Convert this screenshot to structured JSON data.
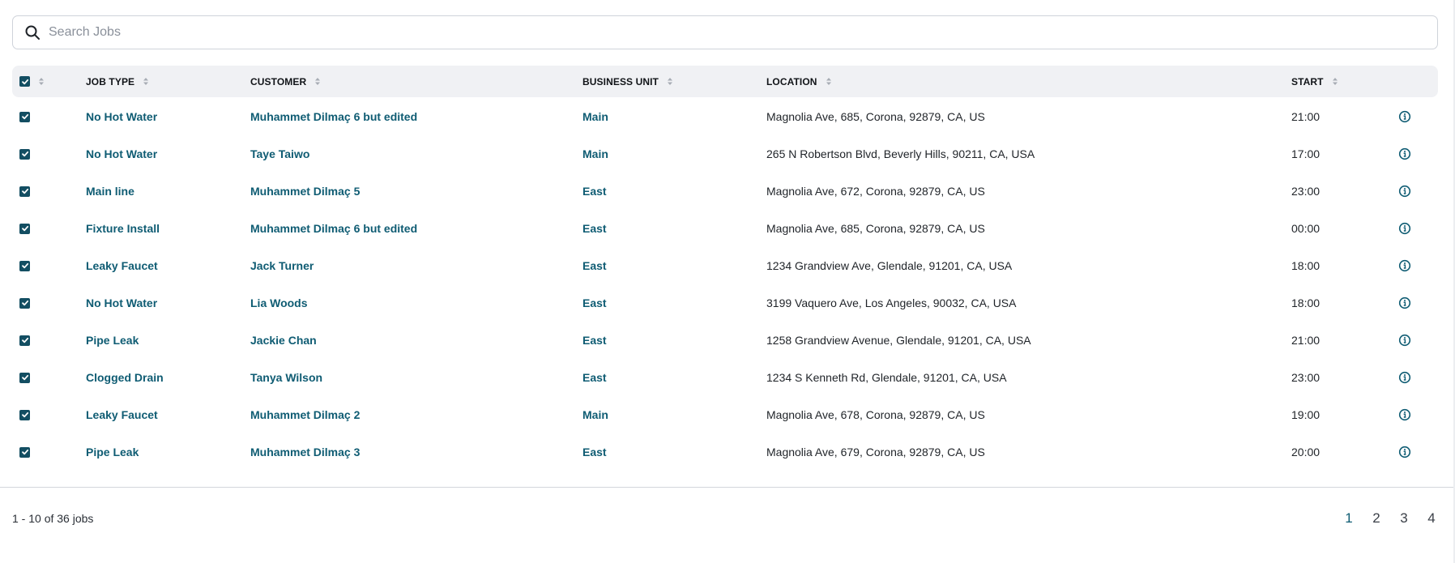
{
  "search": {
    "placeholder": "Search Jobs",
    "value": ""
  },
  "table": {
    "columns": [
      {
        "key": "select",
        "label": ""
      },
      {
        "key": "job_type",
        "label": "JOB TYPE"
      },
      {
        "key": "customer",
        "label": "CUSTOMER"
      },
      {
        "key": "business_unit",
        "label": "BUSINESS UNIT"
      },
      {
        "key": "location",
        "label": "LOCATION"
      },
      {
        "key": "start",
        "label": "START"
      }
    ],
    "select_all_checked": true,
    "rows": [
      {
        "checked": true,
        "job_type": "No Hot Water",
        "customer": "Muhammet Dilmaç 6 but edited",
        "business_unit": "Main",
        "location": "Magnolia Ave, 685, Corona, 92879, CA, US",
        "start": "21:00"
      },
      {
        "checked": true,
        "job_type": "No Hot Water",
        "customer": "Taye Taiwo",
        "business_unit": "Main",
        "location": "265 N Robertson Blvd, Beverly Hills, 90211, CA, USA",
        "start": "17:00"
      },
      {
        "checked": true,
        "job_type": "Main line",
        "customer": "Muhammet Dilmaç 5",
        "business_unit": "East",
        "location": "Magnolia Ave, 672, Corona, 92879, CA, US",
        "start": "23:00"
      },
      {
        "checked": true,
        "job_type": "Fixture Install",
        "customer": "Muhammet Dilmaç 6 but edited",
        "business_unit": "East",
        "location": "Magnolia Ave, 685, Corona, 92879, CA, US",
        "start": "00:00"
      },
      {
        "checked": true,
        "job_type": "Leaky Faucet",
        "customer": "Jack Turner",
        "business_unit": "East",
        "location": "1234 Grandview Ave, Glendale, 91201, CA, USA",
        "start": "18:00"
      },
      {
        "checked": true,
        "job_type": "No Hot Water",
        "customer": "Lia Woods",
        "business_unit": "East",
        "location": "3199 Vaquero Ave, Los Angeles, 90032, CA, USA",
        "start": "18:00"
      },
      {
        "checked": true,
        "job_type": "Pipe Leak",
        "customer": "Jackie Chan",
        "business_unit": "East",
        "location": "1258 Grandview Avenue, Glendale, 91201, CA, USA",
        "start": "21:00"
      },
      {
        "checked": true,
        "job_type": "Clogged Drain",
        "customer": "Tanya Wilson",
        "business_unit": "East",
        "location": "1234 S Kenneth Rd, Glendale, 91201, CA, USA",
        "start": "23:00"
      },
      {
        "checked": true,
        "job_type": "Leaky Faucet",
        "customer": "Muhammet Dilmaç 2",
        "business_unit": "Main",
        "location": "Magnolia Ave, 678, Corona, 92879, CA, US",
        "start": "19:00"
      },
      {
        "checked": true,
        "job_type": "Pipe Leak",
        "customer": "Muhammet Dilmaç 3",
        "business_unit": "East",
        "location": "Magnolia Ave, 679, Corona, 92879, CA, US",
        "start": "20:00"
      }
    ]
  },
  "footer": {
    "count_text": "1 - 10 of 36 jobs",
    "pages": [
      "1",
      "2",
      "3",
      "4"
    ],
    "current_page": "1"
  },
  "colors": {
    "accent": "#0f5c73",
    "checkbox": "#134e62",
    "header_bg": "#f0f1f4"
  },
  "icons": {
    "search": "search-icon",
    "sort": "sort-icon",
    "checkbox": "check-icon",
    "row_action": "info-icon"
  }
}
